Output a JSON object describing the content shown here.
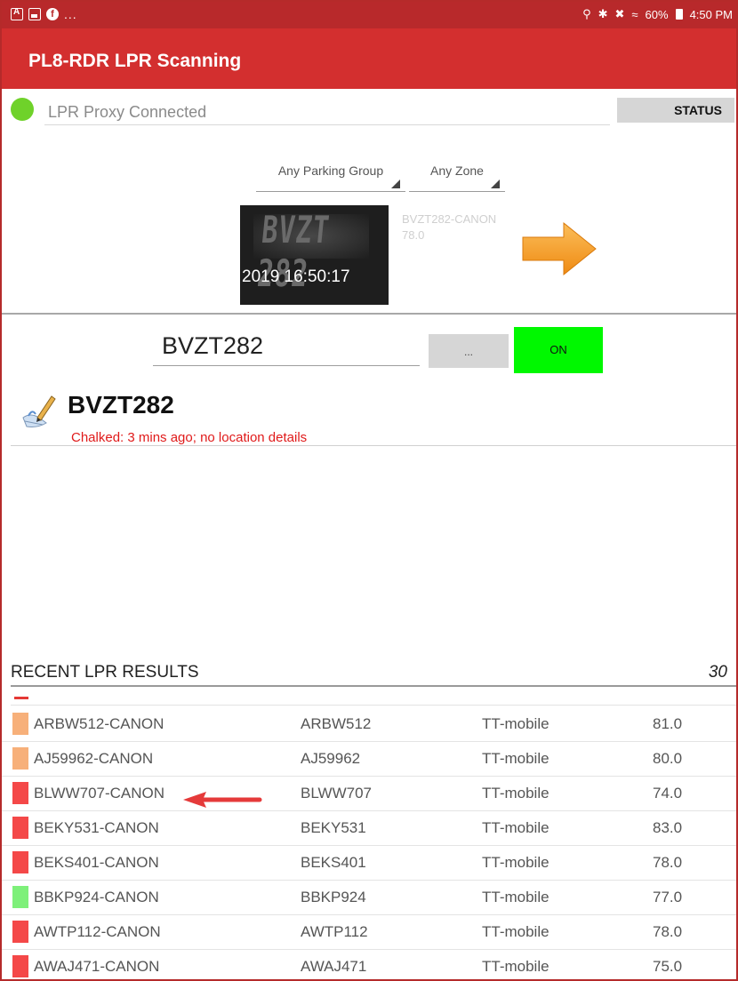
{
  "status_bar": {
    "left_icons": [
      "notification-a-icon",
      "image-icon",
      "info-icon"
    ],
    "overflow": "...",
    "battery_text": "60%",
    "time": "4:50 PM"
  },
  "app": {
    "title": "PL8-RDR LPR Scanning"
  },
  "proxy": {
    "status_text": "LPR Proxy Connected",
    "status_color": "#6fd22a",
    "status_button": "STATUS"
  },
  "filters": {
    "parking_group": "Any Parking Group",
    "zone": "Any Zone"
  },
  "capture": {
    "image_plate_text": "BVZT 282",
    "timestamp": "2019 16:50:17",
    "detection_label": "BVZT282-CANON",
    "detection_score": "78.0"
  },
  "plate_entry": {
    "value": "BVZT282",
    "more_button": "...",
    "on_button": "ON",
    "on_color": "#00f800"
  },
  "result": {
    "plate": "BVZT282",
    "chalk_info": "Chalked: 3 mins ago; no location details"
  },
  "recent": {
    "title": "RECENT LPR RESULTS",
    "count": "30",
    "rows": [
      {
        "camera": "ARBW512-CANON",
        "plate": "ARBW512",
        "device": "TT-mobile",
        "score": "81.0",
        "color": "#f7b07a"
      },
      {
        "camera": "AJ59962-CANON",
        "plate": "AJ59962",
        "device": "TT-mobile",
        "score": "80.0",
        "color": "#f7b07a"
      },
      {
        "camera": "BLWW707-CANON",
        "plate": "BLWW707",
        "device": "TT-mobile",
        "score": "74.0",
        "color": "#f44848"
      },
      {
        "camera": "BEKY531-CANON",
        "plate": "BEKY531",
        "device": "TT-mobile",
        "score": "83.0",
        "color": "#f44848"
      },
      {
        "camera": "BEKS401-CANON",
        "plate": "BEKS401",
        "device": "TT-mobile",
        "score": "78.0",
        "color": "#f44848"
      },
      {
        "camera": "BBKP924-CANON",
        "plate": "BBKP924",
        "device": "TT-mobile",
        "score": "77.0",
        "color": "#7ef07a"
      },
      {
        "camera": "AWTP112-CANON",
        "plate": "AWTP112",
        "device": "TT-mobile",
        "score": "78.0",
        "color": "#f44848"
      },
      {
        "camera": "AWAJ471-CANON",
        "plate": "AWAJ471",
        "device": "TT-mobile",
        "score": "75.0",
        "color": "#f44848"
      }
    ]
  }
}
